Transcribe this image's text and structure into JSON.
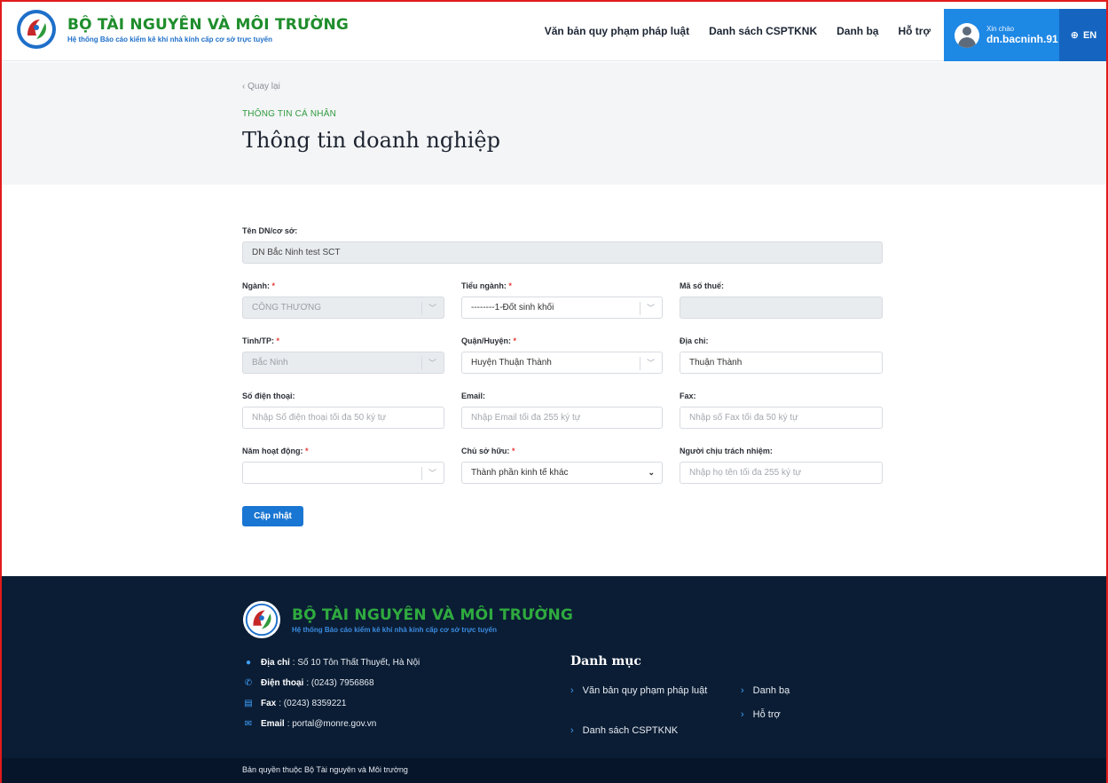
{
  "header": {
    "brand_title": "BỘ TÀI NGUYÊN VÀ MÔI TRƯỜNG",
    "brand_sub": "Hệ thống Báo cáo kiểm kê khí nhà kính cấp cơ sở trực tuyến",
    "nav": [
      "Văn bản quy phạm pháp luật",
      "Danh sách CSPTKNK",
      "Danh bạ",
      "Hỗ trợ"
    ],
    "user_greet": "Xin chào",
    "user_name": "dn.bacninh.91",
    "lang": "EN",
    "accent": "#1e88e5"
  },
  "page": {
    "back": "‹ Quay lại",
    "section": "THÔNG TIN CÁ NHÂN",
    "title": "Thông tin doanh nghiệp"
  },
  "form": {
    "company_label": "Tên DN/cơ sở:",
    "company_value": "DN Bắc Ninh test SCT",
    "nganh_label": "Ngành:",
    "nganh_value": "CÔNG THƯƠNG",
    "tieu_nganh_label": "Tiểu ngành:",
    "tieu_nganh_value": "--------1-Đốt sinh khối",
    "ma_so_thue_label": "Mã số thuế:",
    "ma_so_thue_value": "",
    "tinh_label": "Tỉnh/TP:",
    "tinh_value": "Bắc Ninh",
    "quan_label": "Quận/Huyện:",
    "quan_value": "Huyện Thuận Thành",
    "dia_chi_label": "Địa chỉ:",
    "dia_chi_value": "Thuận Thành",
    "sdt_label": "Số điện thoại:",
    "sdt_placeholder": "Nhập Số điện thoại tối đa 50 ký tự",
    "email_label": "Email:",
    "email_placeholder": "Nhập Email tối đa 255 ký tự",
    "fax_label": "Fax:",
    "fax_placeholder": "Nhập số Fax tối đa 50 ký tự",
    "nam_label": "Năm hoạt động:",
    "nam_value": "",
    "chu_so_huu_label": "Chủ sở hữu:",
    "chu_so_huu_value": "Thành phần kinh tế khác",
    "nguoi_label": "Người chịu trách nhiệm:",
    "nguoi_placeholder": "Nhập họ tên tối đa 255 ký tự",
    "required_mark": "*",
    "submit": "Cập nhật"
  },
  "footer": {
    "brand_title": "BỘ TÀI NGUYÊN VÀ MÔI TRƯỜNG",
    "brand_sub": "Hệ thống Báo cáo kiểm kê khí nhà kính cấp cơ sở trực tuyến",
    "contacts": [
      {
        "icon": "map-marker-icon",
        "key": "Địa chỉ",
        "value": "Số 10 Tôn Thất Thuyết, Hà Nội"
      },
      {
        "icon": "phone-icon",
        "key": "Điện thoại",
        "value": "(0243) 7956868"
      },
      {
        "icon": "fax-icon",
        "key": "Fax",
        "value": "(0243) 8359221"
      },
      {
        "icon": "email-icon",
        "key": "Email",
        "value": "portal@monre.gov.vn"
      }
    ],
    "menu_title": "Danh mục",
    "links": [
      "Văn bản quy phạm pháp luật",
      "Danh sách CSPTKNK",
      "Danh bạ",
      "Hỗ trợ"
    ],
    "copyright": "Bản quyền thuộc Bộ Tài nguyên và Môi trường",
    "bg": "#0b1d34"
  }
}
